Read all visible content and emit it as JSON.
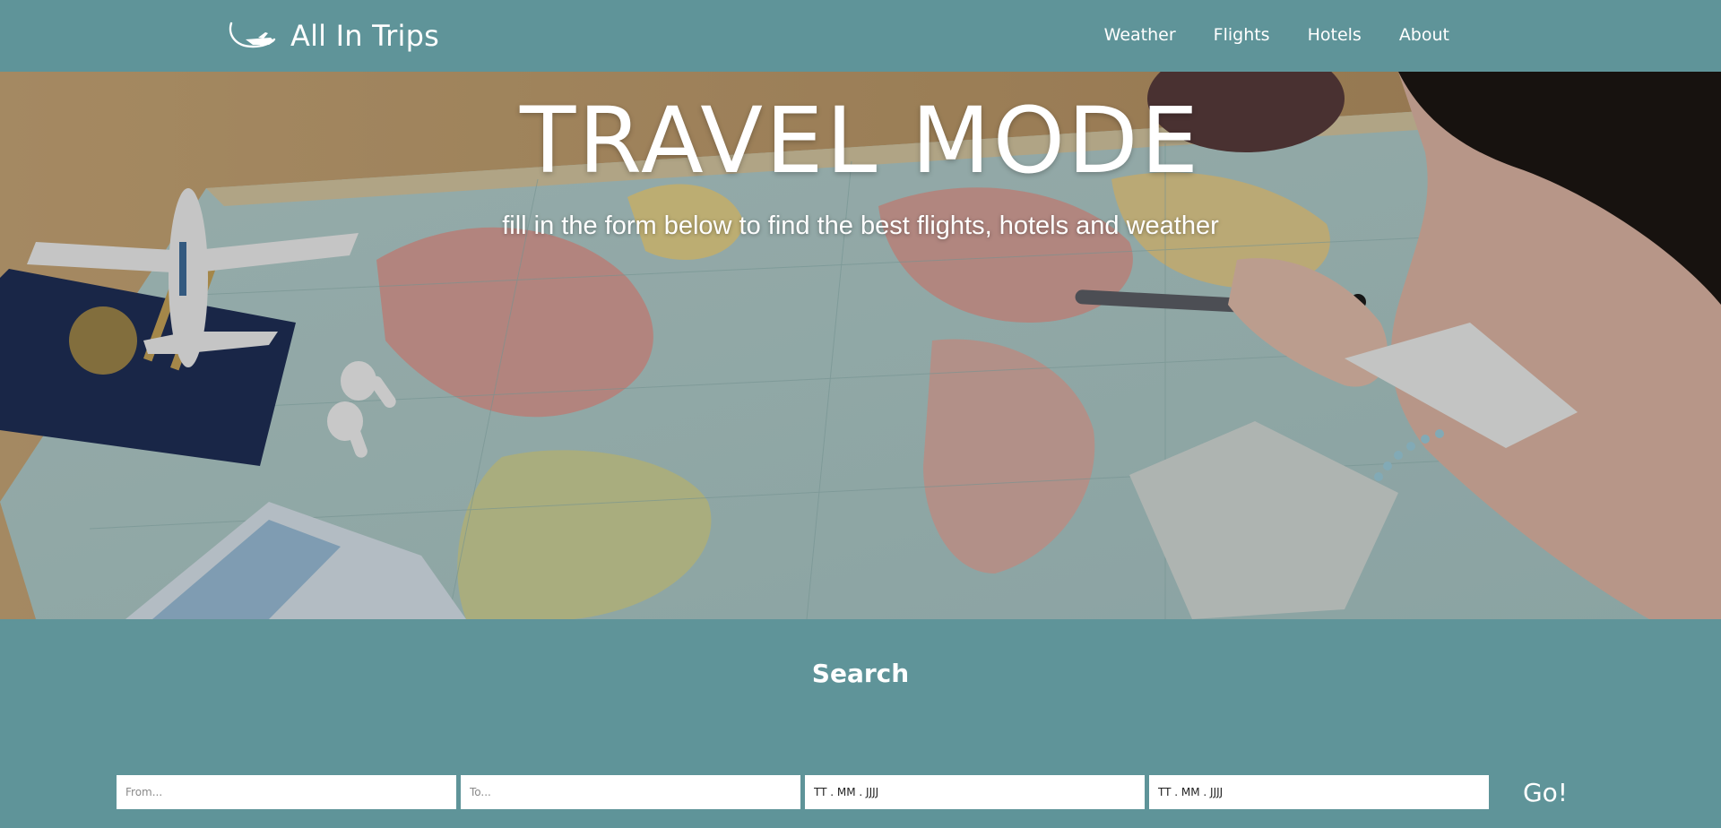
{
  "brand": {
    "name": "All In Trips",
    "icon": "airplane-swoosh-icon"
  },
  "nav": [
    {
      "label": "Weather"
    },
    {
      "label": "Flights"
    },
    {
      "label": "Hotels"
    },
    {
      "label": "About"
    }
  ],
  "hero": {
    "title": "TRAVEL MODE",
    "subtitle": "fill in the form below to find the best flights, hotels and weather"
  },
  "search": {
    "title": "Search",
    "from_placeholder": "From...",
    "to_placeholder": "To...",
    "date_from_value": "TT . MM . JJJJ",
    "date_to_value": "TT . MM . JJJJ",
    "submit_label": "Go!"
  },
  "colors": {
    "primary": "#5f9499",
    "text": "#ffffff"
  }
}
